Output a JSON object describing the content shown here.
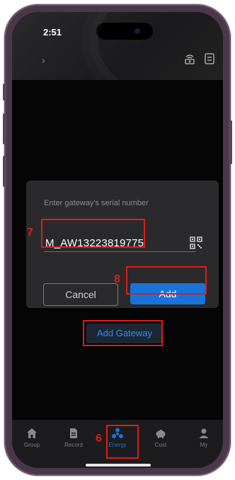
{
  "status_bar": {
    "time": "2:51"
  },
  "header": {
    "back_icon": "chevron-right-icon",
    "icons": [
      "add-gateway-icon",
      "list-icon"
    ]
  },
  "dialog": {
    "title": "Enter gateway's serial number",
    "serial_value": "M_AW13223819775",
    "qr_icon": "qr-code-icon",
    "cancel_label": "Cancel",
    "add_label": "Add"
  },
  "add_gateway_label": "Add Gateway",
  "annotations": {
    "step_7": "7",
    "step_8": "8",
    "step_6": "6"
  },
  "tabbar": {
    "items": [
      {
        "label": "Group",
        "icon": "home-icon"
      },
      {
        "label": "Record",
        "icon": "document-icon"
      },
      {
        "label": "Energy",
        "icon": "energy-icon",
        "active": true
      },
      {
        "label": "Cost",
        "icon": "piggy-bank-icon"
      },
      {
        "label": "My",
        "icon": "user-icon"
      }
    ]
  },
  "colors": {
    "accent": "#1a73d9",
    "highlight": "#e01b1b",
    "dialog_bg": "#2a2a2c"
  }
}
